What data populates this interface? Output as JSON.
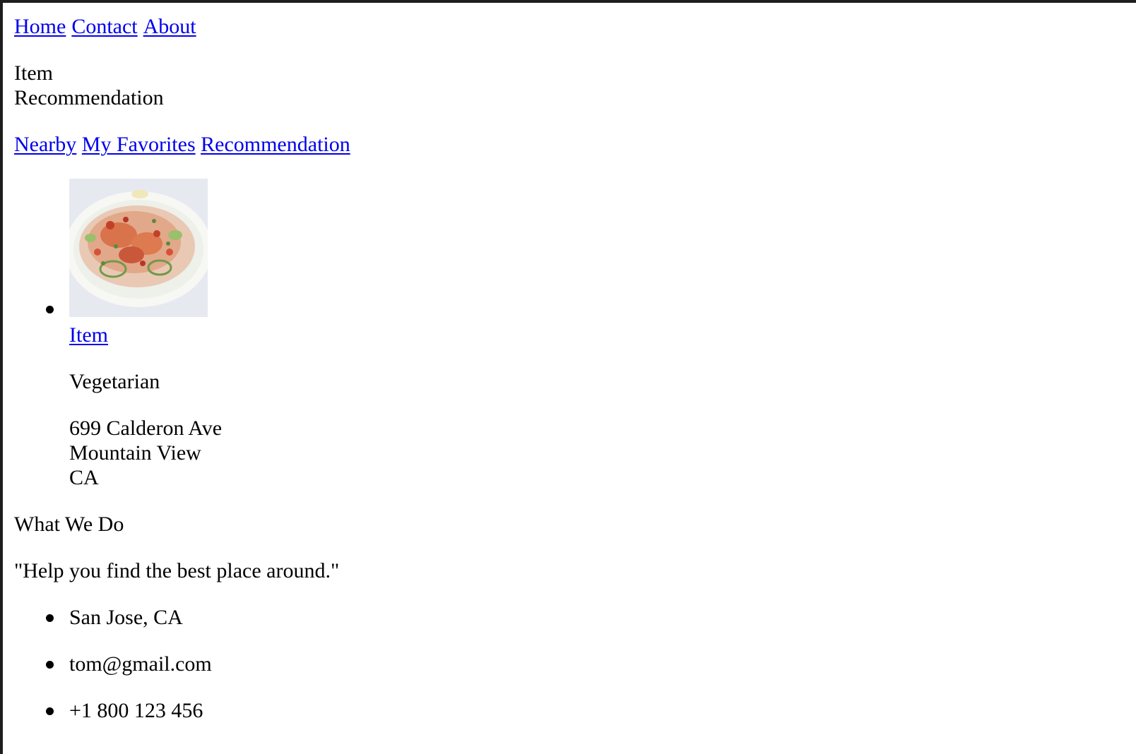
{
  "nav": {
    "links": [
      "Home",
      "Contact",
      "About"
    ]
  },
  "header": {
    "title_line1": "Item",
    "title_line2": "Recommendation"
  },
  "tabs": [
    "Nearby",
    "My Favorites",
    "Recommendation"
  ],
  "items": [
    {
      "image_icon": "food-photo",
      "name": "Item",
      "category": "Vegetarian",
      "address": [
        "699 Calderon Ave",
        "Mountain View",
        "CA"
      ]
    }
  ],
  "about": {
    "heading": "What We Do",
    "quote": "\"Help you find the best place around.\""
  },
  "contact": {
    "location": "San Jose, CA",
    "email": "tom@gmail.com",
    "phone": "+1 800 123 456"
  },
  "colors": {
    "link": "#0000ee",
    "text": "#000000",
    "frame": "#1e1e1e"
  }
}
